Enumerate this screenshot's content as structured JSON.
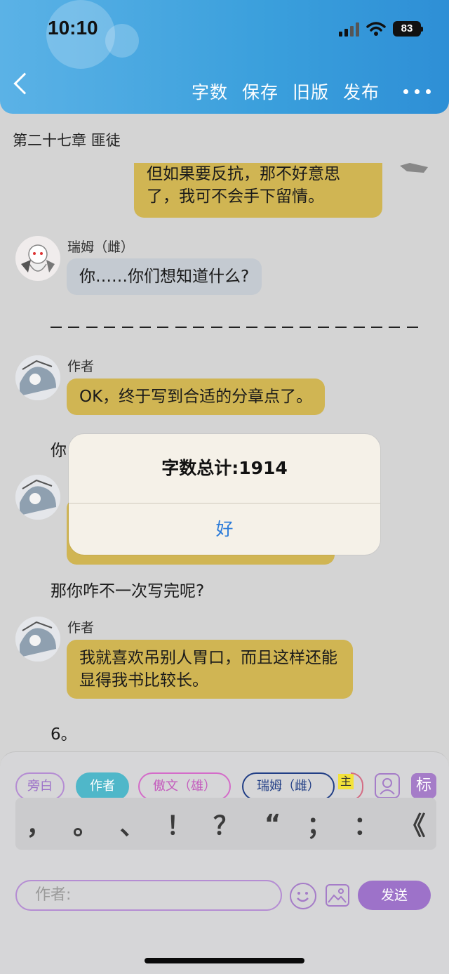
{
  "status_bar": {
    "time": "10:10",
    "battery": "83"
  },
  "toolbar": {
    "word_count": "字数",
    "save": "保存",
    "old_version": "旧版",
    "publish": "发布"
  },
  "chapter_title": "第二十七章 匪徒",
  "messages": [
    {
      "text": "但如果要反抗，那不好意思了，我可不会手下留情。"
    },
    {
      "speaker": "瑞姆（雌）",
      "text": "你……你们想知道什么?"
    },
    {
      "speaker": "作者",
      "text": "OK，终于写到合适的分章点了。"
    },
    {
      "text": "你"
    },
    {
      "text": "那你咋不一次写完呢?"
    },
    {
      "speaker": "作者",
      "text": "我就喜欢吊别人胃口，而且这样还能显得我书比较长。"
    },
    {
      "text": "6。"
    }
  ],
  "alert": {
    "title": "字数总计:1914",
    "ok": "好"
  },
  "roles": [
    "旁白",
    "作者",
    "傲文（雄）",
    "瑞姆（雌）"
  ],
  "role_tag": "主",
  "mark_label": "标",
  "punctuation": [
    "，",
    "。",
    "、",
    "！",
    "？",
    "“",
    "；",
    "：",
    "《"
  ],
  "input": {
    "placeholder": "作者:"
  },
  "send_label": "发送",
  "colors": {
    "header": "#3a9fdc",
    "bubble_yellow": "#d0b553",
    "bubble_grey": "#c4cad1",
    "send": "#9d72c9",
    "alert_link": "#2b7bd9"
  }
}
